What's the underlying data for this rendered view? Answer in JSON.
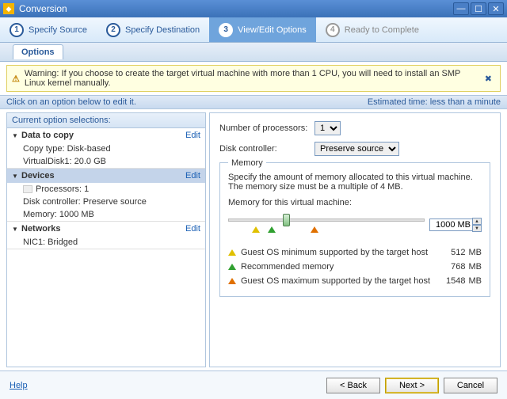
{
  "window": {
    "title": "Conversion"
  },
  "steps": [
    {
      "num": "1",
      "label": "Specify Source"
    },
    {
      "num": "2",
      "label": "Specify Destination"
    },
    {
      "num": "3",
      "label": "View/Edit Options"
    },
    {
      "num": "4",
      "label": "Ready to Complete"
    }
  ],
  "options_tab": "Options",
  "warning": "Warning: If you choose to create the target virtual machine with more than 1 CPU, you will need to install an SMP Linux kernel manually.",
  "subheader": {
    "hint": "Click on an option below to edit it.",
    "eta_label": "Estimated time:",
    "eta_value": "less than a minute"
  },
  "left": {
    "title": "Current option selections:",
    "edit": "Edit",
    "groups": [
      {
        "name": "Data to copy",
        "items": [
          "Copy type: Disk-based",
          "VirtualDisk1: 20.0 GB"
        ]
      },
      {
        "name": "Devices",
        "items": [
          "Processors: 1",
          "Disk controller: Preserve source",
          "Memory: 1000 MB"
        ]
      },
      {
        "name": "Networks",
        "items": [
          "NIC1: Bridged"
        ]
      }
    ]
  },
  "right": {
    "num_proc_label": "Number of processors:",
    "num_proc_value": "1",
    "disk_ctrl_label": "Disk controller:",
    "disk_ctrl_value": "Preserve source",
    "memory_legend": "Memory",
    "memory_desc": "Specify the amount of memory allocated to this virtual machine. The memory size must be a multiple of 4 MB.",
    "memory_label": "Memory for this virtual machine:",
    "memory_value": "1000 MB",
    "legend": [
      {
        "color": "yell",
        "text": "Guest OS minimum supported by the target host",
        "val": "512",
        "unit": "MB"
      },
      {
        "color": "grn",
        "text": "Recommended memory",
        "val": "768",
        "unit": "MB"
      },
      {
        "color": "orng",
        "text": "Guest OS maximum supported by the target host",
        "val": "1548",
        "unit": "MB"
      }
    ]
  },
  "footer": {
    "help": "Help",
    "back": "< Back",
    "next": "Next >",
    "cancel": "Cancel"
  }
}
